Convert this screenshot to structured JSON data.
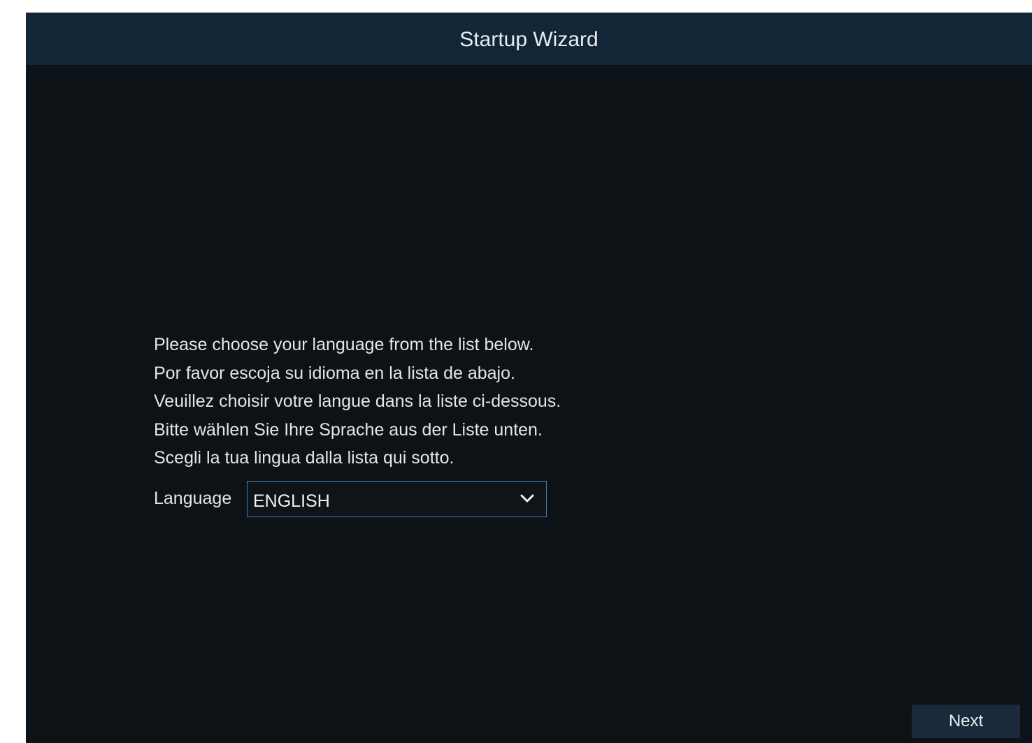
{
  "window": {
    "title": "Startup Wizard"
  },
  "instructions": [
    "Please choose your language from the list below.",
    "Por favor escoja su idioma en la lista de abajo.",
    "Veuillez choisir votre langue dans la liste ci-dessous.",
    "Bitte wählen Sie Ihre Sprache aus der Liste unten.",
    "Scegli la tua lingua dalla lista qui sotto."
  ],
  "language": {
    "label": "Language",
    "selected": "ENGLISH",
    "dropdown_icon": "chevron-down-icon"
  },
  "footer": {
    "next_label": "Next"
  },
  "colors": {
    "titlebar": "#132638",
    "background": "#0d1217",
    "select_border": "#3a7fc8",
    "button": "#1a2a3a"
  }
}
